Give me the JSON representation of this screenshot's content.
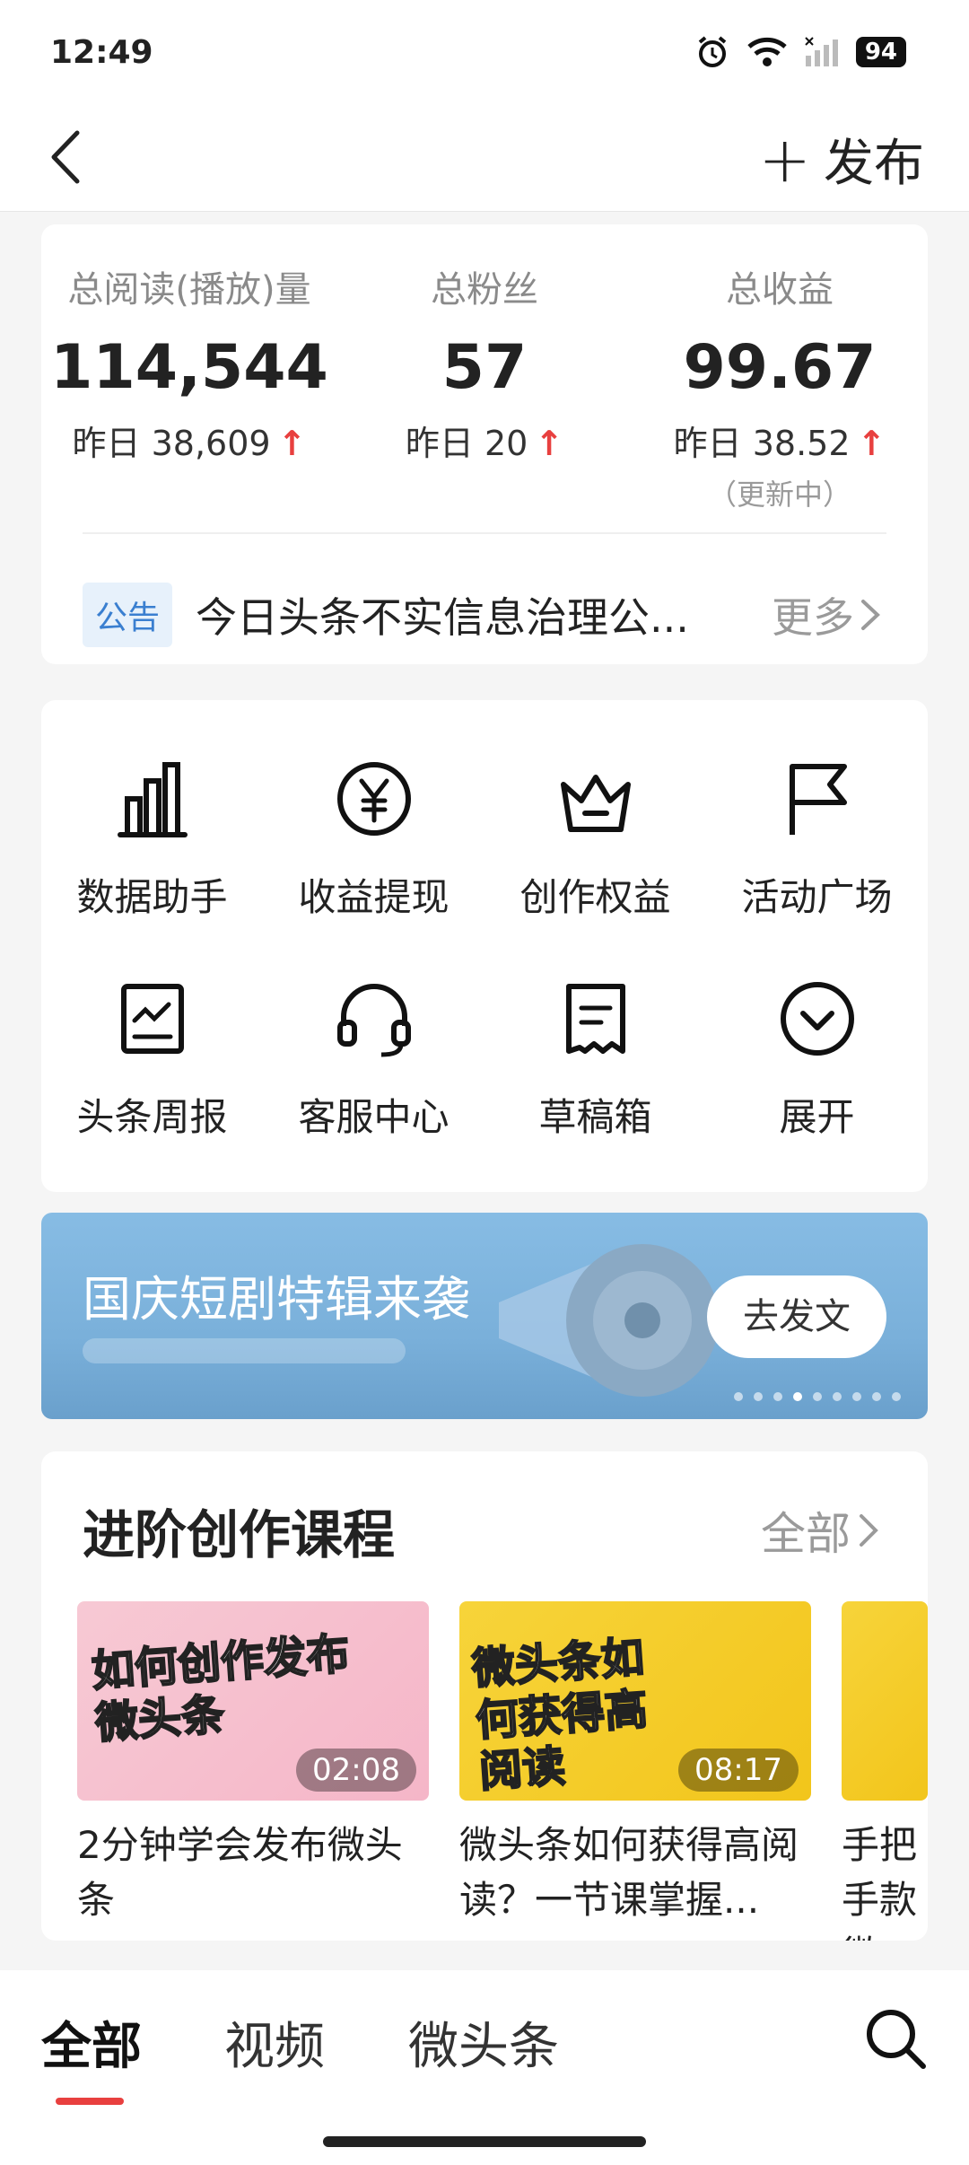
{
  "status_bar": {
    "time": "12:49",
    "battery": "94"
  },
  "nav": {
    "back_label": "返回",
    "publish_label": "发布"
  },
  "stats": [
    {
      "label": "总阅读(播放)量",
      "value": "114,544",
      "delta": "昨日 38,609",
      "note": ""
    },
    {
      "label": "总粉丝",
      "value": "57",
      "delta": "昨日 20",
      "note": ""
    },
    {
      "label": "总收益",
      "value": "99.67",
      "delta": "昨日 38.52",
      "note": "（更新中）"
    }
  ],
  "notice": {
    "tag": "公告",
    "text": "今日头条不实信息治理公...",
    "more": "更多"
  },
  "tools": [
    {
      "label": "数据助手",
      "icon": "bar-chart-icon"
    },
    {
      "label": "收益提现",
      "icon": "yuan-icon"
    },
    {
      "label": "创作权益",
      "icon": "crown-icon"
    },
    {
      "label": "活动广场",
      "icon": "flag-icon"
    },
    {
      "label": "头条周报",
      "icon": "report-icon"
    },
    {
      "label": "客服中心",
      "icon": "headset-icon"
    },
    {
      "label": "草稿箱",
      "icon": "draft-icon"
    },
    {
      "label": "展开",
      "icon": "expand-icon"
    }
  ],
  "banner": {
    "title": "国庆短剧特辑来袭",
    "button": "去发文",
    "page_count": 9,
    "active_page": 4
  },
  "courses": {
    "title": "进阶创作课程",
    "all_label": "全部",
    "items": [
      {
        "thumb_text": "如何创作发布微头条",
        "duration": "02:08",
        "title": "2分钟学会发布微头条"
      },
      {
        "thumb_text": "微头条如何获得高阅读",
        "duration": "08:17",
        "title": "微头条如何获得高阅读？一节课掌握..."
      },
      {
        "thumb_text": "",
        "duration": "",
        "title": "手把手款微"
      }
    ]
  },
  "tabs": [
    "全部",
    "视频",
    "微头条"
  ],
  "colors": {
    "accent_red": "#e8403f",
    "notice_blue": "#3a7fd0",
    "banner_blue": "#7ab0da"
  }
}
